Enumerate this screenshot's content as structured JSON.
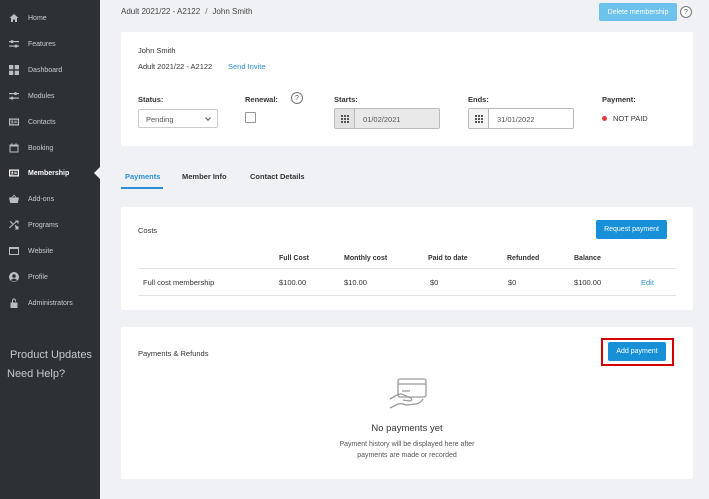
{
  "sidebar": {
    "items": [
      {
        "label": "Home",
        "icon": "home-icon"
      },
      {
        "label": "Features",
        "icon": "sliders-icon"
      },
      {
        "label": "Dashboard",
        "icon": "grid-icon"
      },
      {
        "label": "Modules",
        "icon": "sliders-icon"
      },
      {
        "label": "Contacts",
        "icon": "id-card-icon"
      },
      {
        "label": "Booking",
        "icon": "calendar-icon"
      },
      {
        "label": "Membership",
        "icon": "id-card-icon"
      },
      {
        "label": "Add-ons",
        "icon": "basket-icon"
      },
      {
        "label": "Programs",
        "icon": "shuffle-icon"
      },
      {
        "label": "Website",
        "icon": "browser-icon"
      },
      {
        "label": "Profile",
        "icon": "user-icon"
      },
      {
        "label": "Administrators",
        "icon": "lock-icon"
      }
    ],
    "active": "Membership",
    "product_updates": "Product Updates",
    "need_help": "Need Help?"
  },
  "breadcrumb": {
    "membership": "Adult 2021/22 - A2122",
    "separator": "/",
    "member": "John Smith"
  },
  "header": {
    "delete_label": "Delete membership",
    "help": "?"
  },
  "member": {
    "name": "John Smith",
    "membership_code": "Adult 2021/22 - A2122",
    "send_invite": "Send Invite",
    "status_label": "Status:",
    "status_value": "Pending",
    "renewal_label": "Renewal:",
    "renewal_help": "?",
    "starts_label": "Starts:",
    "starts_value": "01/02/2021",
    "ends_label": "Ends:",
    "ends_value": "31/01/2022",
    "payment_label": "Payment:",
    "payment_value": "NOT PAID",
    "payment_color": "#e23d3d"
  },
  "tabs": [
    {
      "label": "Payments",
      "active": true
    },
    {
      "label": "Member Info",
      "active": false
    },
    {
      "label": "Contact Details",
      "active": false
    }
  ],
  "costs": {
    "title": "Costs",
    "request_label": "Request payment",
    "headers": [
      "Full Cost",
      "Monthly cost",
      "Paid to date",
      "Refunded",
      "Balance"
    ],
    "row": {
      "name": "Full cost membership",
      "values": [
        "$100.00",
        "$10.00",
        "$0",
        "$0",
        "$100.00"
      ],
      "edit": "Edit"
    }
  },
  "payments": {
    "title": "Payments & Refunds",
    "add_label": "Add payment",
    "empty_title": "No payments yet",
    "empty_line1": "Payment history will be displayed here after",
    "empty_line2": "payments are made or recorded"
  },
  "colors": {
    "accent": "#1790d8",
    "sidebar": "#2d3136",
    "highlight": "#d40000"
  }
}
